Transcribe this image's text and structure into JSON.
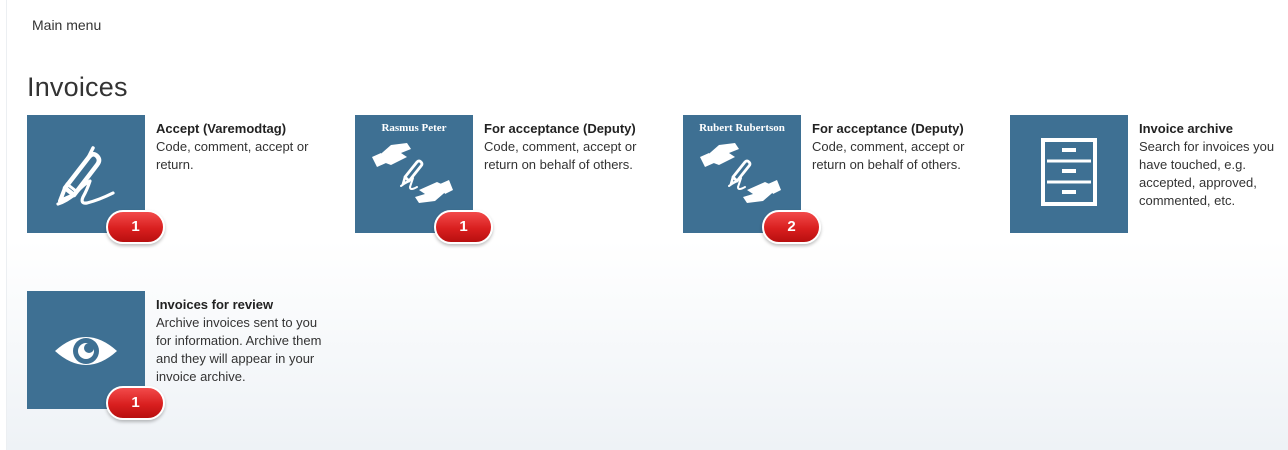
{
  "nav": {
    "main_menu": "Main menu"
  },
  "page": {
    "title": "Invoices"
  },
  "colors": {
    "tile_bg": "#3e7093",
    "badge_red": "#d91f1f"
  },
  "tiles": [
    {
      "icon": "pen-signature-icon",
      "title": "Accept (Varemodtag)",
      "description": "Code, comment, accept or return.",
      "badge": "1"
    },
    {
      "icon": "hands-signature-icon",
      "person": "Rasmus Peter",
      "title": "For acceptance (Deputy)",
      "description": "Code, comment, accept or return on behalf of others.",
      "badge": "1"
    },
    {
      "icon": "hands-signature-icon",
      "person": "Rubert Rubertson",
      "title": "For acceptance (Deputy)",
      "description": "Code, comment, accept or return on behalf of others.",
      "badge": "2"
    },
    {
      "icon": "file-cabinet-icon",
      "title": "Invoice archive",
      "description": "Search for invoices you have touched, e.g. accepted, approved, commented, etc."
    },
    {
      "icon": "eye-icon",
      "title": "Invoices for review",
      "description": "Archive invoices sent to you for information. Archive them and they will appear in your invoice archive.",
      "badge": "1"
    }
  ]
}
